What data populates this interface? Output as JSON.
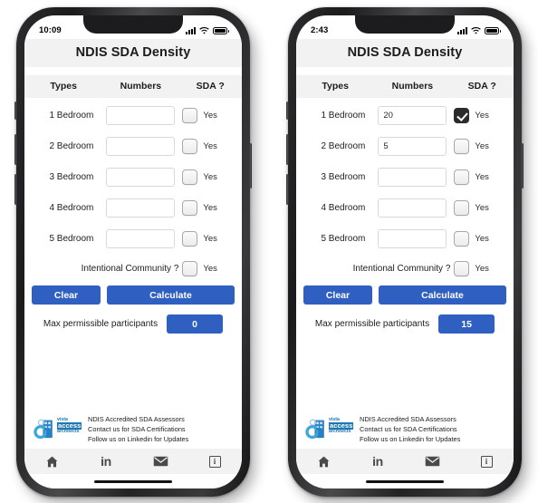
{
  "app": {
    "title": "NDIS SDA Density",
    "table_headers": {
      "types": "Types",
      "numbers": "Numbers",
      "sda": "SDA ?"
    },
    "yes_label": "Yes",
    "intentional_community_label": "Intentional Community ?",
    "clear_label": "Clear",
    "calculate_label": "Calculate",
    "result_label": "Max permissible participants",
    "accent_color": "#2f5fc0",
    "header_bg_color": "#f2f2f2",
    "checked_box_color": "#2b2b2b",
    "footer": {
      "logo": {
        "line1": "vista",
        "line2": "access",
        "line3": "architects"
      },
      "lines": [
        "NDIS Accredited SDA Assessors",
        "Contact us for SDA Certifications",
        "Follow us on Linkedin for Updates"
      ]
    },
    "nav": [
      {
        "name": "home-icon",
        "label": ""
      },
      {
        "name": "linkedin-icon",
        "label": "in"
      },
      {
        "name": "mail-icon",
        "label": ""
      },
      {
        "name": "info-icon",
        "label": "i"
      }
    ]
  },
  "phones": [
    {
      "id": "phone-left",
      "status": {
        "time": "10:09",
        "signal": "signal-icon",
        "wifi": "wifi-icon",
        "battery": "battery-icon"
      },
      "rows": [
        {
          "type": "1 Bedroom",
          "number": "",
          "checked": false
        },
        {
          "type": "2 Bedroom",
          "number": "",
          "checked": false
        },
        {
          "type": "3 Bedroom",
          "number": "",
          "checked": false
        },
        {
          "type": "4 Bedroom",
          "number": "",
          "checked": false
        },
        {
          "type": "5 Bedroom",
          "number": "",
          "checked": false
        }
      ],
      "intentional_community_checked": false,
      "result_value": "0"
    },
    {
      "id": "phone-right",
      "status": {
        "time": "2:43",
        "signal": "signal-icon",
        "wifi": "wifi-icon",
        "battery": "battery-icon"
      },
      "rows": [
        {
          "type": "1 Bedroom",
          "number": "20",
          "checked": true
        },
        {
          "type": "2 Bedroom",
          "number": "5",
          "checked": false
        },
        {
          "type": "3 Bedroom",
          "number": "",
          "checked": false
        },
        {
          "type": "4 Bedroom",
          "number": "",
          "checked": false
        },
        {
          "type": "5 Bedroom",
          "number": "",
          "checked": false
        }
      ],
      "intentional_community_checked": false,
      "result_value": "15"
    }
  ]
}
